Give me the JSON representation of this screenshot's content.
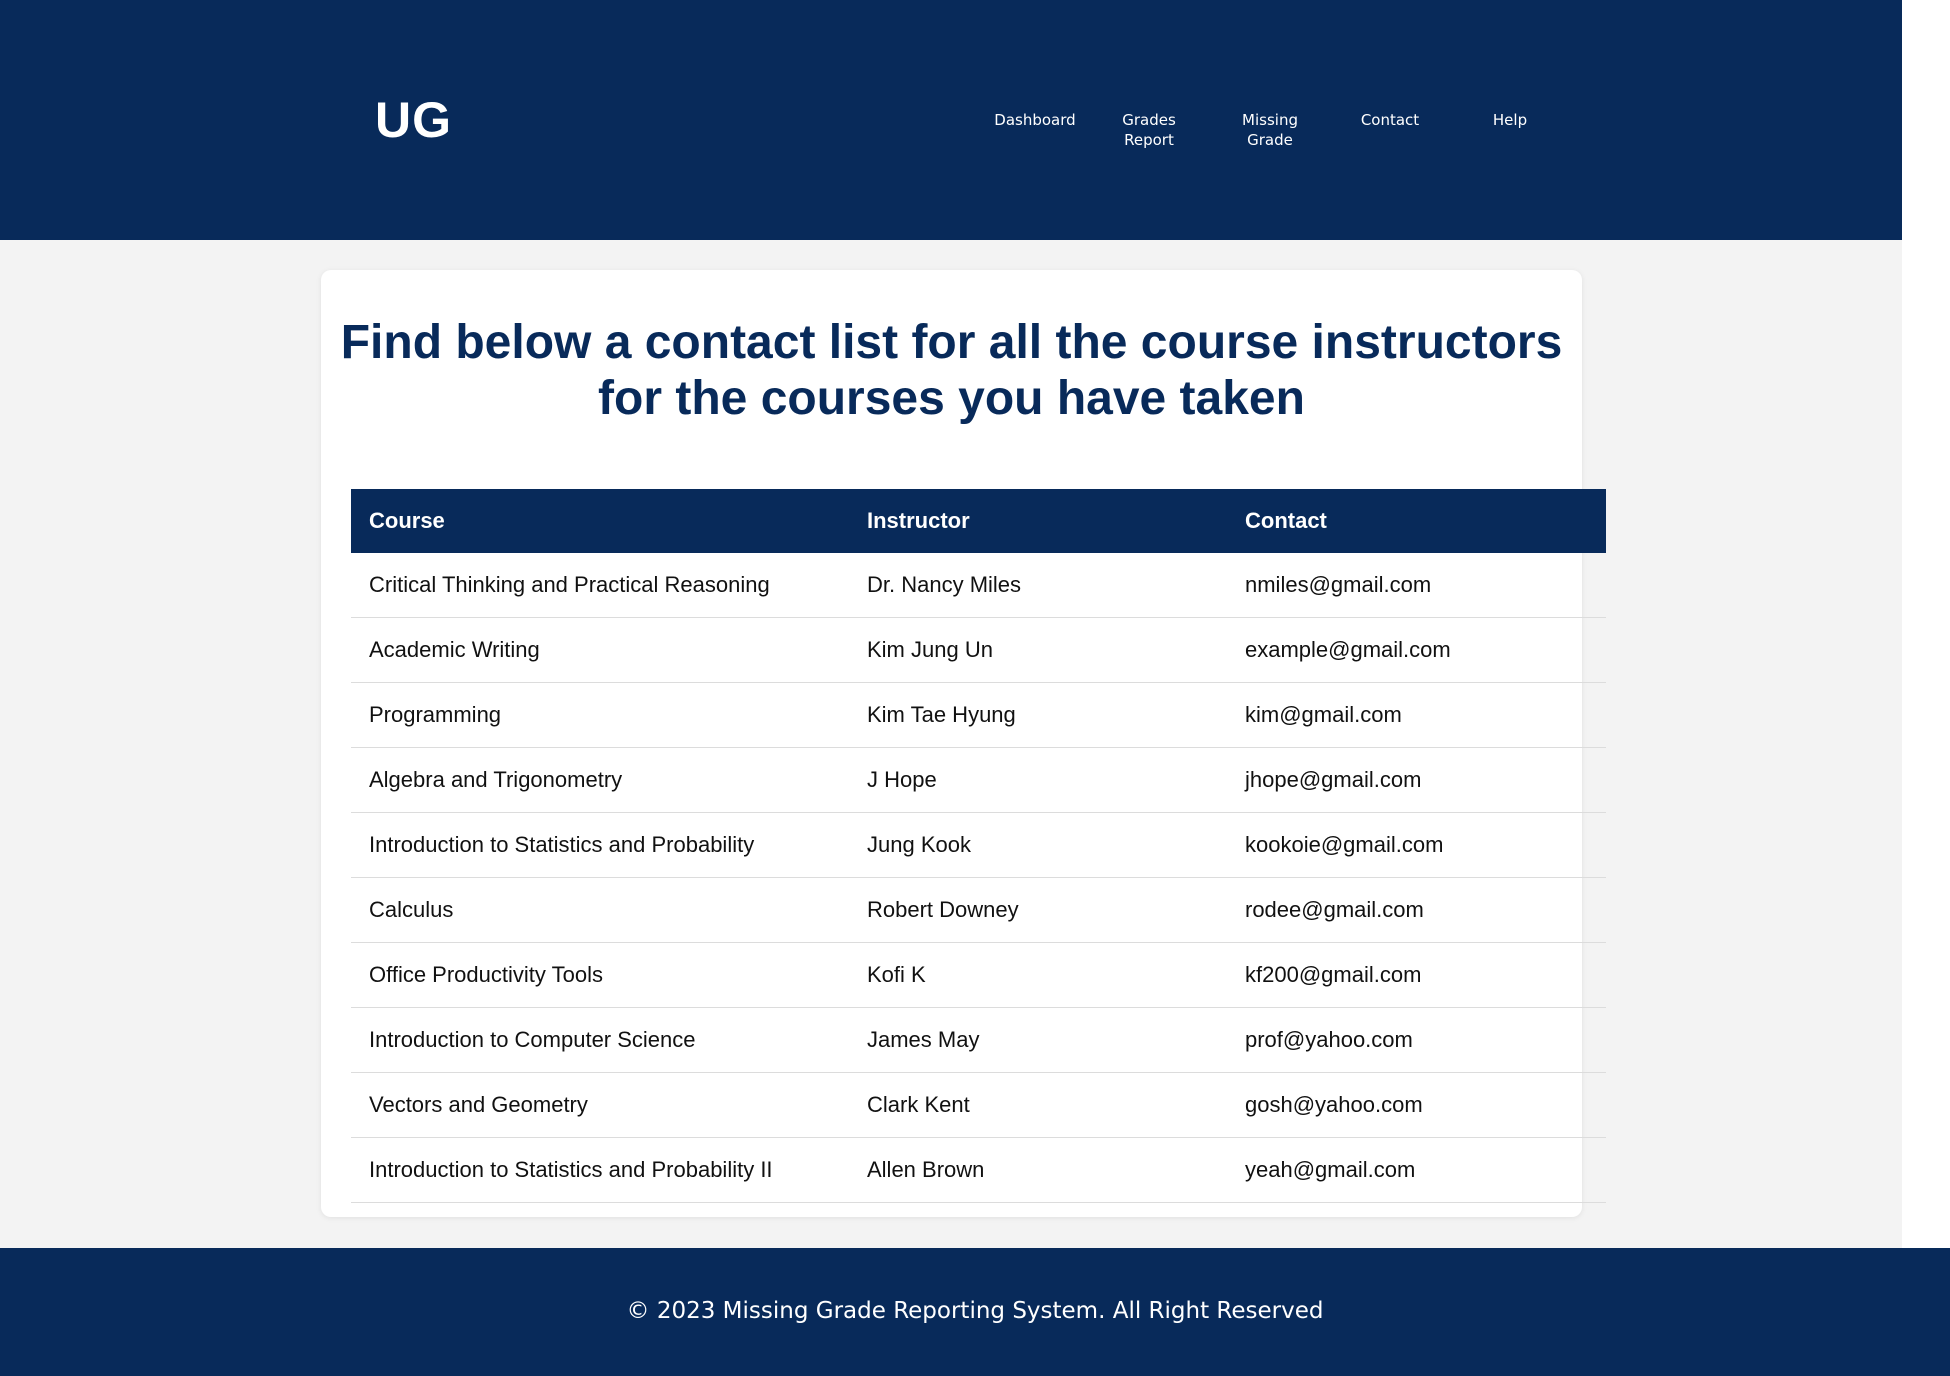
{
  "header": {
    "logo": "UG",
    "nav": [
      {
        "label": "Dashboard"
      },
      {
        "label": "Grades\nReport"
      },
      {
        "label": "Missing\nGrade"
      },
      {
        "label": "Contact"
      },
      {
        "label": "Help"
      }
    ]
  },
  "main": {
    "heading": "Find below a contact list for all the course instructors for the courses you have taken",
    "table": {
      "headers": [
        "Course",
        "Instructor",
        "Contact"
      ],
      "rows": [
        [
          "Critical Thinking and Practical Reasoning",
          "Dr. Nancy Miles",
          "nmiles@gmail.com"
        ],
        [
          "Academic Writing",
          "Kim Jung Un",
          "example@gmail.com"
        ],
        [
          "Programming",
          "Kim Tae Hyung",
          "kim@gmail.com"
        ],
        [
          "Algebra and Trigonometry",
          "J Hope",
          "jhope@gmail.com"
        ],
        [
          "Introduction to Statistics and Probability",
          "Jung Kook",
          "kookoie@gmail.com"
        ],
        [
          "Calculus",
          "Robert Downey",
          "rodee@gmail.com"
        ],
        [
          "Office Productivity Tools",
          "Kofi K",
          "kf200@gmail.com"
        ],
        [
          "Introduction to Computer Science",
          "James May",
          "prof@yahoo.com"
        ],
        [
          "Vectors and Geometry",
          "Clark Kent",
          "gosh@yahoo.com"
        ],
        [
          "Introduction to Statistics and Probability II",
          "Allen Brown",
          "yeah@gmail.com"
        ]
      ]
    }
  },
  "footer": {
    "text": "© 2023 Missing Grade Reporting System. All Right Reserved"
  },
  "colors": {
    "brand_navy": "#082a5a",
    "page_background": "#f3f3f3",
    "card_background": "#ffffff"
  }
}
